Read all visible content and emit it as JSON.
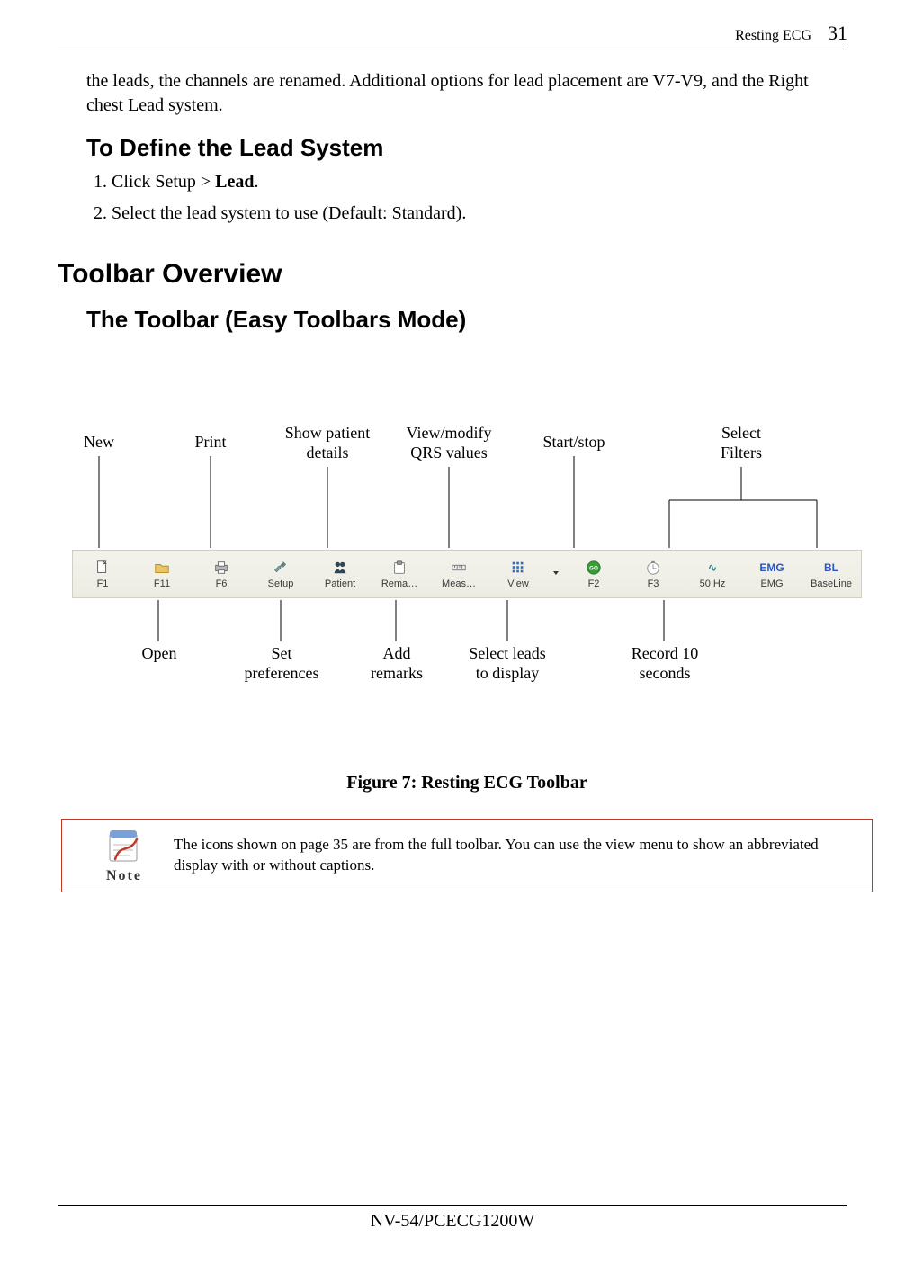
{
  "header": {
    "section": "Resting ECG",
    "page_number": "31"
  },
  "intro_paragraph": "the leads, the channels are renamed. Additional options for lead placement are V7-V9, and the Right chest Lead system.",
  "define_lead": {
    "heading": "To Define the Lead System",
    "steps_prefix": [
      "Click Setup > ",
      "Select the lead system to use (Default: Standard)."
    ],
    "step1_bold": "Lead",
    "step1_suffix": "."
  },
  "toolbar_overview": {
    "heading": "Toolbar Overview",
    "subheading": "The Toolbar (Easy Toolbars Mode)"
  },
  "callouts_top": {
    "new": "New",
    "print": "Print",
    "patient": "Show patient\ndetails",
    "qrs": "View/modify\nQRS values",
    "startstop": "Start/stop",
    "filters": "Select\nFilters"
  },
  "callouts_bottom": {
    "open": "Open",
    "prefs": "Set\npreferences",
    "remarks": "Add\nremarks",
    "leads": "Select leads\nto display",
    "record": "Record 10\nseconds"
  },
  "toolbar": {
    "items": [
      {
        "key": "F1",
        "cap": "F1",
        "icon": "doc"
      },
      {
        "key": "F11",
        "cap": "F11",
        "icon": "open"
      },
      {
        "key": "F6",
        "cap": "F6",
        "icon": "print"
      },
      {
        "key": "Setup",
        "cap": "Setup",
        "icon": "wrench"
      },
      {
        "key": "Patient",
        "cap": "Patient",
        "icon": "people"
      },
      {
        "key": "Rema",
        "cap": "Rema…",
        "icon": "clip"
      },
      {
        "key": "Meas",
        "cap": "Meas…",
        "icon": "ruler"
      },
      {
        "key": "View",
        "cap": "View",
        "icon": "grid"
      },
      {
        "key": "drop",
        "cap": "",
        "icon": "drop"
      },
      {
        "key": "F2",
        "cap": "F2",
        "icon": "go"
      },
      {
        "key": "F3",
        "cap": "F3",
        "icon": "clock"
      },
      {
        "key": "50Hz",
        "cap": "50 Hz",
        "icon": "wave",
        "txt": "∿",
        "cls": "txt-teal"
      },
      {
        "key": "EMG",
        "cap": "EMG",
        "icon": "text",
        "txt": "EMG",
        "cls": "txt-blue"
      },
      {
        "key": "BL",
        "cap": "BaseLine",
        "icon": "text",
        "txt": "BL",
        "cls": "txt-blue"
      }
    ]
  },
  "figure_caption": "Figure 7: Resting ECG Toolbar",
  "note": {
    "label": "Note",
    "text": "The icons shown on page 35 are from the full toolbar. You can use the view menu to show an abbreviated display with or without captions."
  },
  "footer": "NV-54/PCECG1200W"
}
